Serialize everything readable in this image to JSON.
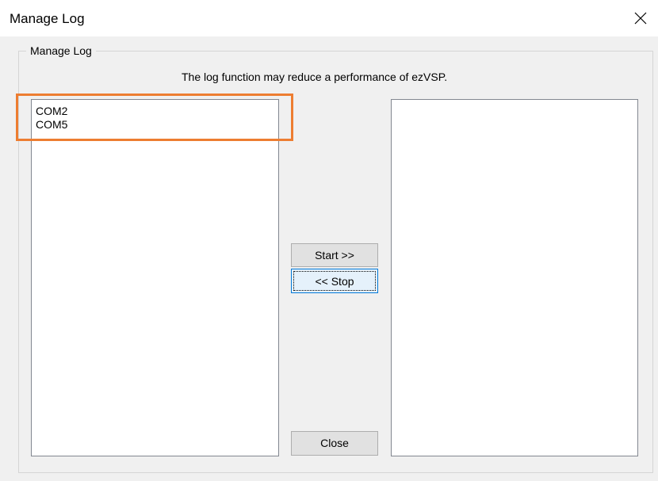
{
  "window": {
    "title": "Manage Log"
  },
  "group": {
    "legend": "Manage Log",
    "notice": "The log function may reduce a performance of ezVSP."
  },
  "available_ports": [
    "COM2",
    "COM5"
  ],
  "logging_ports": [],
  "buttons": {
    "start": "Start >>",
    "stop": "<< Stop",
    "close": "Close"
  },
  "colors": {
    "highlight": "#ed7d31",
    "focus_border": "#0078d7"
  },
  "icons": {
    "close": "close-x-icon"
  }
}
